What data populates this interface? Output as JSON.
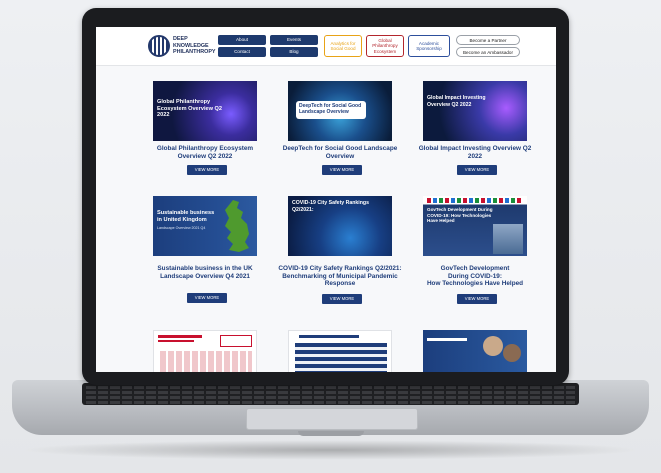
{
  "header": {
    "logo_lines": [
      "DEEP",
      "KNOWLEDGE",
      "PHILANTHROPY"
    ],
    "nav": {
      "about": "About",
      "events": "Events",
      "contact": "Contact",
      "blog": "Blog"
    },
    "analytics": "Analytics for Social Good",
    "global_line1": "Global",
    "global_line2": "Philanthropy",
    "global_line3": "Ecosystem",
    "academic_line1": "Academic",
    "academic_line2": "Sponsorship",
    "partner": "Become a Partner",
    "ambassador": "Become an Ambassador"
  },
  "cards": [
    {
      "thumb_title": "Global Philanthropy Ecosystem Overview Q2 2022",
      "title": "Global Philanthropy Ecosystem Overview Q2 2022",
      "button": "VIEW MORE"
    },
    {
      "thumb_title": "DeepTech for Social Good Landscape Overview",
      "title": "DeepTech for Social Good Landscape Overview",
      "button": "VIEW MORE"
    },
    {
      "thumb_title": "Global Impact Investing Overview Q2 2022",
      "title": "Global Impact Investing Overview Q2 2022",
      "button": "VIEW MORE"
    },
    {
      "thumb_title": "Sustainable business in United Kingdom",
      "thumb_sub": "Landscape Overview 2021 Q4",
      "title": "Sustainable business in the UK Landscape Overview Q4 2021",
      "button": "VIEW MORE"
    },
    {
      "thumb_title": "COVID-19 City Safety Rankings Q2/2021:",
      "title": "COVID-19 City Safety Rankings Q2/2021: Benchmarking of Municipal Pandemic Response",
      "button": "VIEW MORE"
    },
    {
      "thumb_title": "GovTech Development During COVID-19: How Technologies Have Helped",
      "title_l1": "GovTech Development",
      "title_l2": "During COVID-19:",
      "title_l3": "How Technologies Have Helped",
      "button": "VIEW MORE"
    }
  ],
  "colors": {
    "navy": "#1e3a6e",
    "title_blue": "#1f3d7a",
    "analytics": "#e8a317",
    "global": "#b3262d",
    "academic": "#2d4f9c"
  }
}
